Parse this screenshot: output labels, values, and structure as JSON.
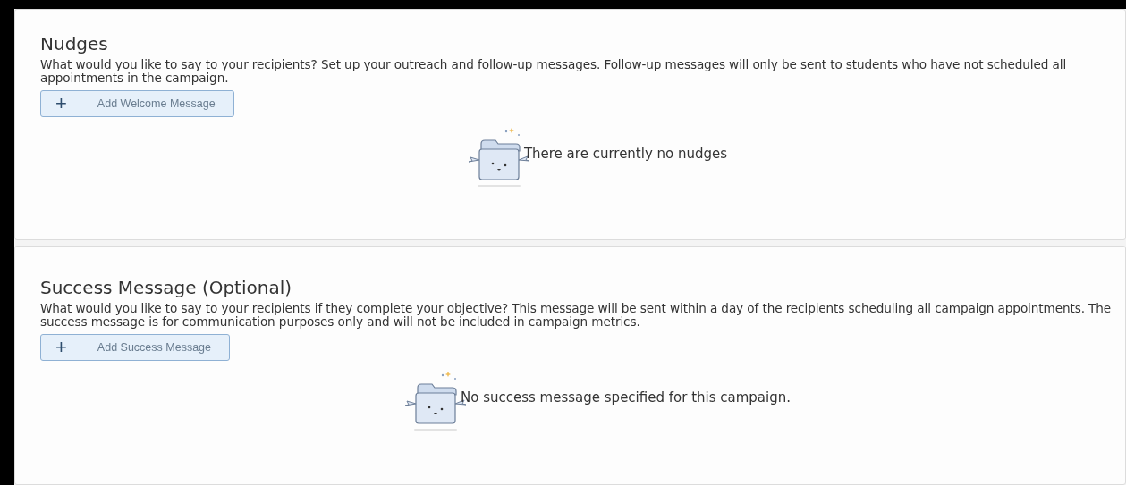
{
  "sections": [
    {
      "title": "Nudges",
      "description": "What would you like to say to your recipients? Set up your outreach and follow-up messages. Follow-up messages will only be sent to students who have not scheduled all appointments in the campaign.",
      "button": {
        "icon": "+",
        "label": "Add Welcome Message"
      },
      "empty_text": "There are currently no nudges"
    },
    {
      "title": "Success Message (Optional)",
      "description": "What would you like to say to your recipients if they complete your objective? This message will be sent within a day of the recipients scheduling all campaign appointments. The success message is for communication purposes only and will not be included in campaign metrics.",
      "button": {
        "icon": "+",
        "label": "Add Success Message"
      },
      "empty_text": "No success message specified for this campaign."
    }
  ]
}
